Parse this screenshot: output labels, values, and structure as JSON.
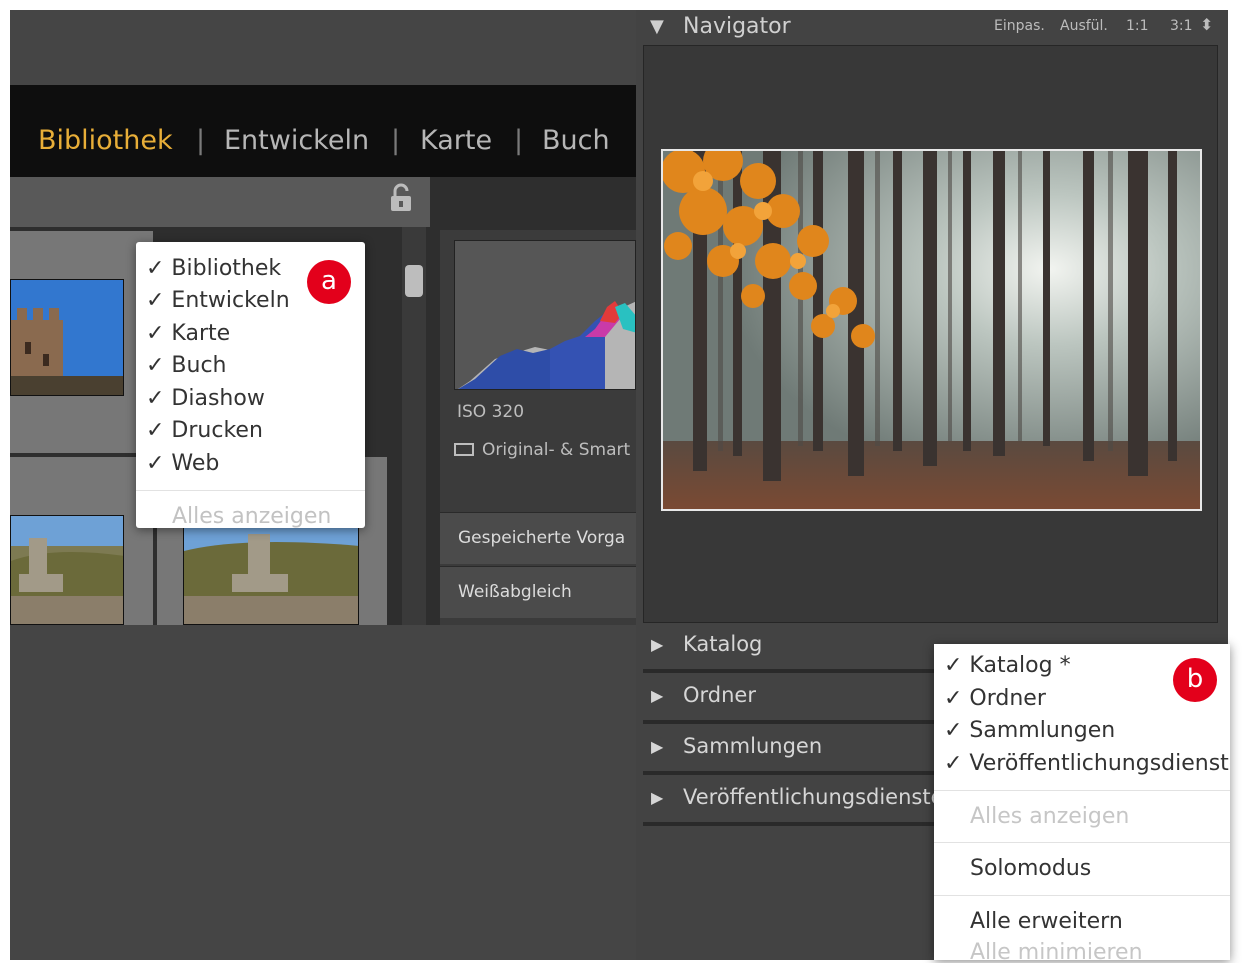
{
  "module_bar": {
    "modules": [
      "Bibliothek",
      "Entwickeln",
      "Karte",
      "Buch"
    ],
    "active_module": "Bibliothek",
    "separator": "|",
    "active_color": "#e8ae38"
  },
  "module_menu": {
    "badge": "a",
    "items": [
      "✓ Bibliothek",
      "✓ Entwickeln",
      "✓ Karte",
      "✓ Buch",
      "✓ Diashow",
      "✓ Drucken",
      "✓ Web"
    ],
    "show_all": "Alles anzeigen"
  },
  "library_grid": {
    "lock_icon": "lock-icon"
  },
  "develop_panel": {
    "iso": "ISO 320",
    "original_smart": "Original- & Smart",
    "sections": [
      "Gespeicherte Vorga",
      "Weißabgleich"
    ]
  },
  "navigator": {
    "title": "Navigator",
    "zoom_options": [
      "Einpas.",
      "Ausfül.",
      "1:1",
      "3:1"
    ],
    "stepper_symbol": "⬍"
  },
  "panel_sections": [
    "Katalog",
    "Ordner",
    "Sammlungen",
    "Veröffentlichungsdienste"
  ],
  "panel_menu": {
    "badge": "b",
    "items": [
      "✓ Katalog *",
      "✓ Ordner",
      "✓ Sammlungen",
      "✓ Veröffentlichungsdienste"
    ],
    "show_all": "Alles anzeigen",
    "solo_mode": "Solomodus",
    "expand_all": "Alle erweitern",
    "collapse_all": "Alle minimieren"
  },
  "colors": {
    "badge_red": "#e3001b",
    "active_module": "#e8ae38"
  }
}
